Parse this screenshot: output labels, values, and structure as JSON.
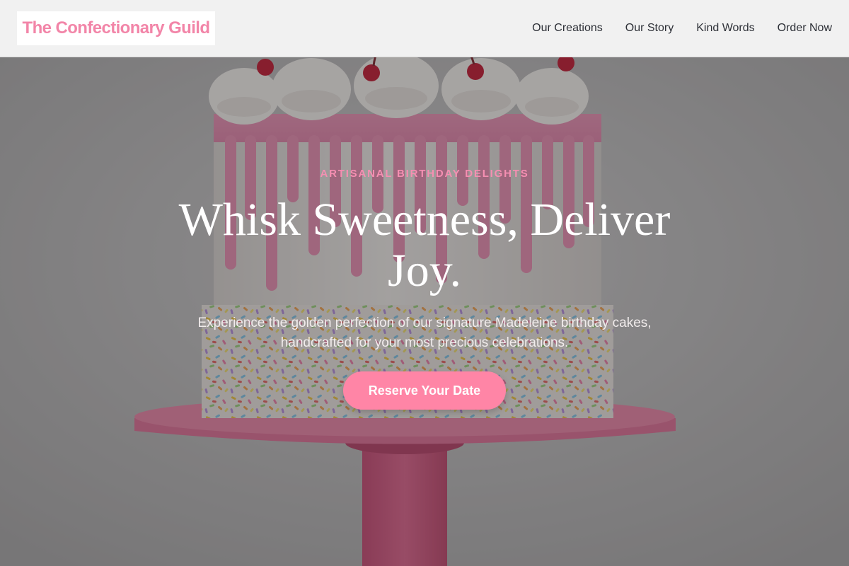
{
  "header": {
    "logo": "The Confectionary Guild",
    "nav": [
      "Our Creations",
      "Our Story",
      "Kind Words",
      "Order Now"
    ]
  },
  "hero": {
    "eyebrow": "ARTISANAL BIRTHDAY DELIGHTS",
    "headline_line1": "Whisk Sweetness, Deliver",
    "headline_line2": "Joy.",
    "subtext_line1": "Experience the golden perfection of our signature Madeleine birthday cakes,",
    "subtext_line2": "handcrafted for your most precious celebrations.",
    "cta_label": "Reserve Your Date"
  },
  "colors": {
    "brand_pink": "#f285a8",
    "cta_pink": "#ff85a6",
    "eyebrow_pink": "#f58fb2",
    "header_bg": "#f1f1f1"
  }
}
